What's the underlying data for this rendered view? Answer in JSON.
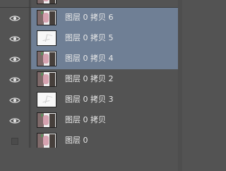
{
  "layers_panel": {
    "layers": [
      {
        "name": "",
        "visible": true,
        "selected": false,
        "thumbnail": "photo"
      },
      {
        "name": "图层 0 拷贝 6",
        "visible": true,
        "selected": true,
        "thumbnail": "photo"
      },
      {
        "name": "图层 0 拷贝 5",
        "visible": true,
        "selected": true,
        "thumbnail": "sketch"
      },
      {
        "name": "图层 0 拷贝 4",
        "visible": true,
        "selected": true,
        "thumbnail": "photo"
      },
      {
        "name": "图层 0 拷贝 2",
        "visible": true,
        "selected": false,
        "thumbnail": "photo"
      },
      {
        "name": "图层 0 拷贝 3",
        "visible": true,
        "selected": false,
        "thumbnail": "sketch"
      },
      {
        "name": "图层 0 拷贝",
        "visible": true,
        "selected": false,
        "thumbnail": "photo"
      },
      {
        "name": "图层 0",
        "visible": false,
        "selected": false,
        "thumbnail": "photo"
      }
    ]
  }
}
